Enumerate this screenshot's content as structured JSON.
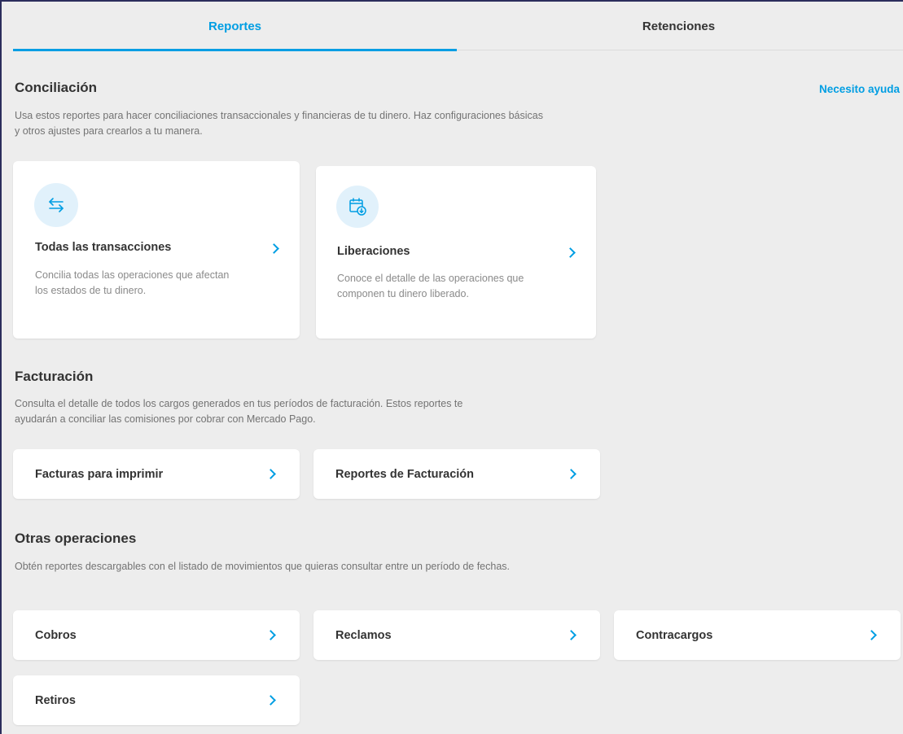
{
  "tabs": [
    {
      "label": "Reportes",
      "active": true
    },
    {
      "label": "Retenciones",
      "active": false
    }
  ],
  "help_link": "Necesito ayuda",
  "sections": {
    "conciliacion": {
      "title": "Conciliación",
      "desc": "Usa estos reportes para hacer conciliaciones transaccionales y financieras de tu dinero. Haz configuraciones básicas y otros ajustes para crearlos a tu manera.",
      "cards": [
        {
          "label": "Todas las transacciones",
          "desc": "Concilia todas las operaciones que afectan los estados de tu dinero.",
          "icon": "transfer-arrows-icon"
        },
        {
          "label": "Liberaciones",
          "desc": "Conoce el detalle de las operaciones que componen tu dinero liberado.",
          "icon": "calendar-download-icon"
        }
      ]
    },
    "facturacion": {
      "title": "Facturación",
      "desc": "Consulta el detalle de todos los cargos generados en tus períodos de facturación. Estos reportes te ayudarán a conciliar las comisiones por cobrar con Mercado Pago.",
      "cards": [
        {
          "label": "Facturas para imprimir"
        },
        {
          "label": "Reportes de Facturación"
        }
      ]
    },
    "otras": {
      "title": "Otras operaciones",
      "desc": "Obtén reportes descargables con el listado de movimientos que quieras consultar entre un período de fechas.",
      "cards": [
        {
          "label": "Cobros"
        },
        {
          "label": "Reclamos"
        },
        {
          "label": "Contracargos"
        },
        {
          "label": "Retiros"
        }
      ]
    }
  },
  "colors": {
    "accent": "#009ee3",
    "background": "#ededed",
    "card": "#ffffff",
    "icon_bg": "#e1f1fb"
  }
}
